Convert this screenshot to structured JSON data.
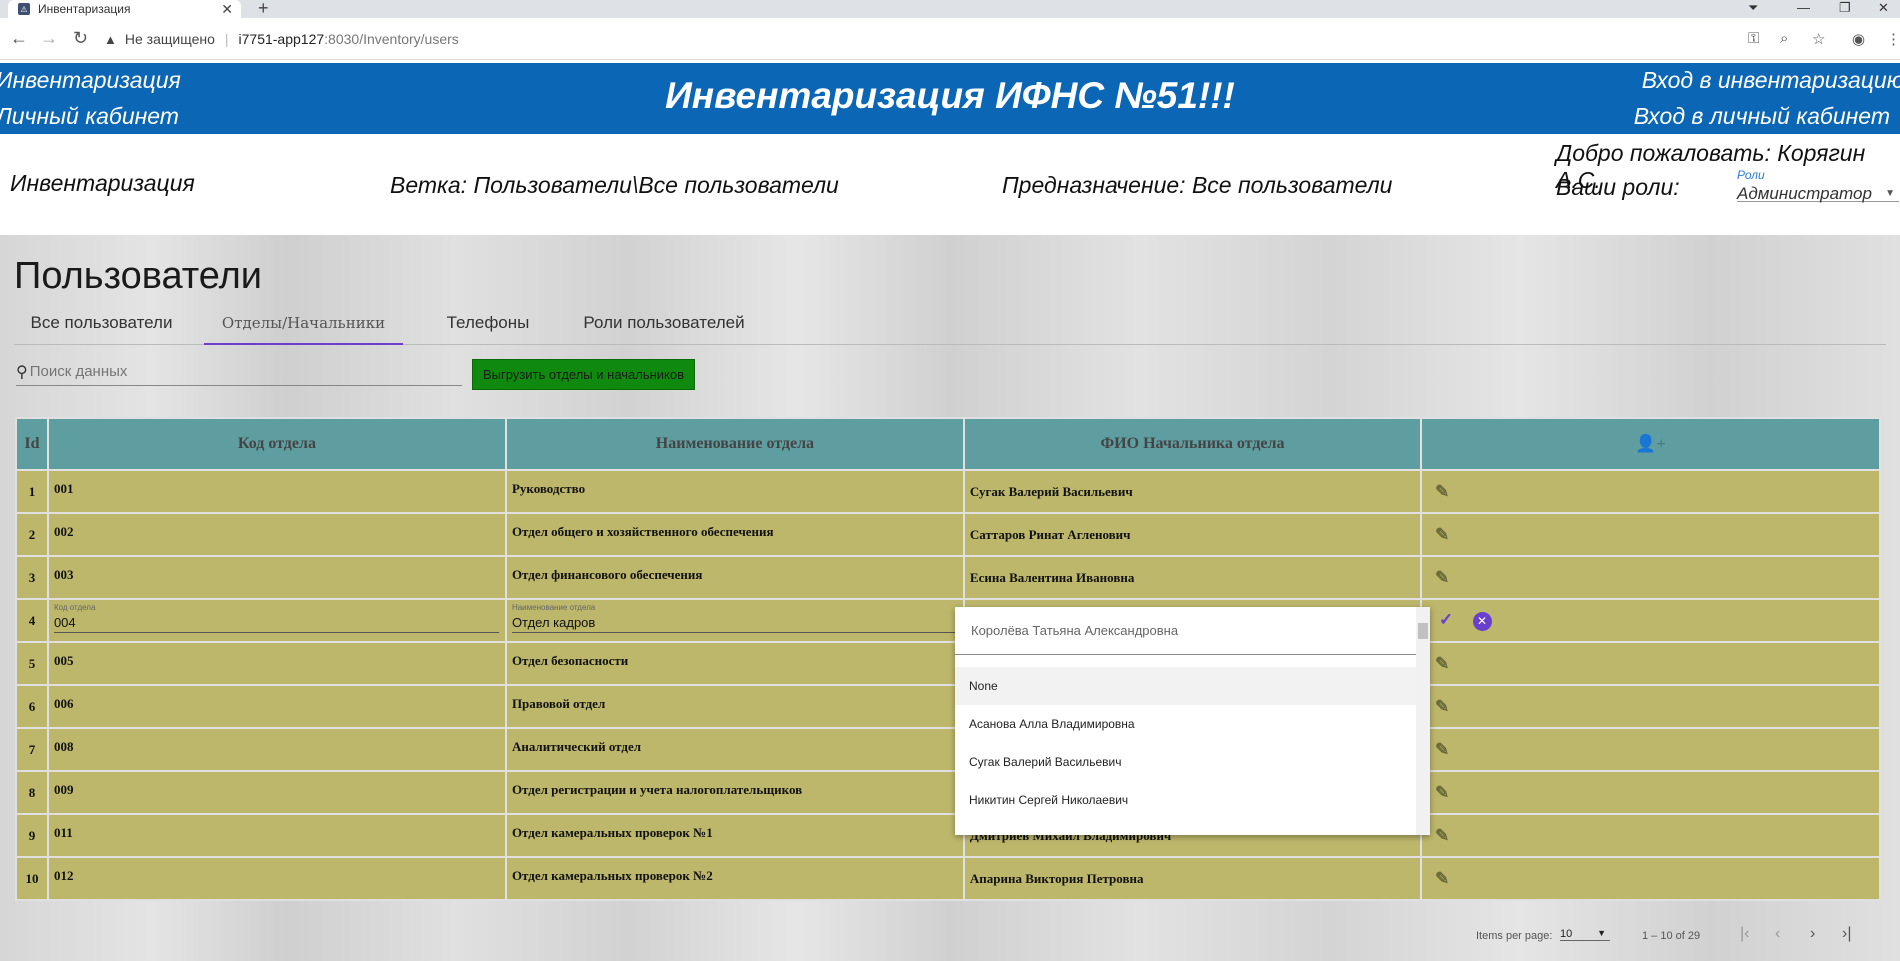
{
  "browser": {
    "tab_title": "Инвентаризация",
    "security": "Не защищено",
    "url_host": "i7751-app127",
    "url_rest": ":8030/Inventory/users"
  },
  "header": {
    "left_top": "Инвентаризация",
    "left_bottom": "Личный кабинет",
    "title": "Инвентаризация ИФНС №51!!!",
    "right_top": "Вход в инвентаризацию",
    "right_bottom": "Вход в личный кабинет"
  },
  "info": {
    "section": "Инвентаризация",
    "branch": "Ветка: Пользователи\\Все пользователи",
    "purpose": "Предназначение: Все пользователи",
    "greeting": "Добро пожаловать: Корягин А.С.",
    "roles_label": "Ваши роли:",
    "roles_field_label": "Роли",
    "roles_value": "Администратор"
  },
  "page": {
    "title": "Пользователи",
    "tabs": [
      {
        "label": "Все пользователи"
      },
      {
        "label": "Отделы/Начальники"
      },
      {
        "label": "Телефоны"
      },
      {
        "label": "Роли пользователей"
      }
    ],
    "search_placeholder": "Поиск данных",
    "export_button": "Выгрузить отделы и начальников"
  },
  "table": {
    "headers": [
      "Id",
      "Код отдела",
      "Наименование отдела",
      "ФИО Начальника отдела"
    ],
    "rows": [
      {
        "id": "1",
        "code": "001",
        "name": "Руководство",
        "head": "Сугак Валерий Васильевич"
      },
      {
        "id": "2",
        "code": "002",
        "name": "Отдел общего и хозяйственного обеспечения",
        "head": "Саттаров Ринат Агленович"
      },
      {
        "id": "3",
        "code": "003",
        "name": "Отдел финансового обеспечения",
        "head": "Есина Валентина Ивановна"
      },
      {
        "id": "4",
        "code": "004",
        "name": "Отдел кадров",
        "head": ""
      },
      {
        "id": "5",
        "code": "005",
        "name": "Отдел безопасности",
        "head": ""
      },
      {
        "id": "6",
        "code": "006",
        "name": "Правовой отдел",
        "head": ""
      },
      {
        "id": "7",
        "code": "008",
        "name": "Аналитический отдел",
        "head": ""
      },
      {
        "id": "8",
        "code": "009",
        "name": "Отдел регистрации и учета налогоплательщиков",
        "head": ""
      },
      {
        "id": "9",
        "code": "011",
        "name": "Отдел камеральных проверок №1",
        "head": "Дмитриев Михаил Владимирович"
      },
      {
        "id": "10",
        "code": "012",
        "name": "Отдел камеральных проверок №2",
        "head": "Апарина Виктория Петровна"
      }
    ],
    "edit_code_label": "Код отдела",
    "edit_name_label": "Наименование отдела"
  },
  "dropdown": {
    "search_value": "Королёва Татьяна Александровна",
    "options": [
      "None",
      "Асанова Алла Владимировна",
      "Сугак Валерий Васильевич",
      "Никитин Сергей Николаевич"
    ]
  },
  "paginator": {
    "items_per_page_label": "Items per page:",
    "page_size": "10",
    "range": "1 – 10 of 29"
  }
}
